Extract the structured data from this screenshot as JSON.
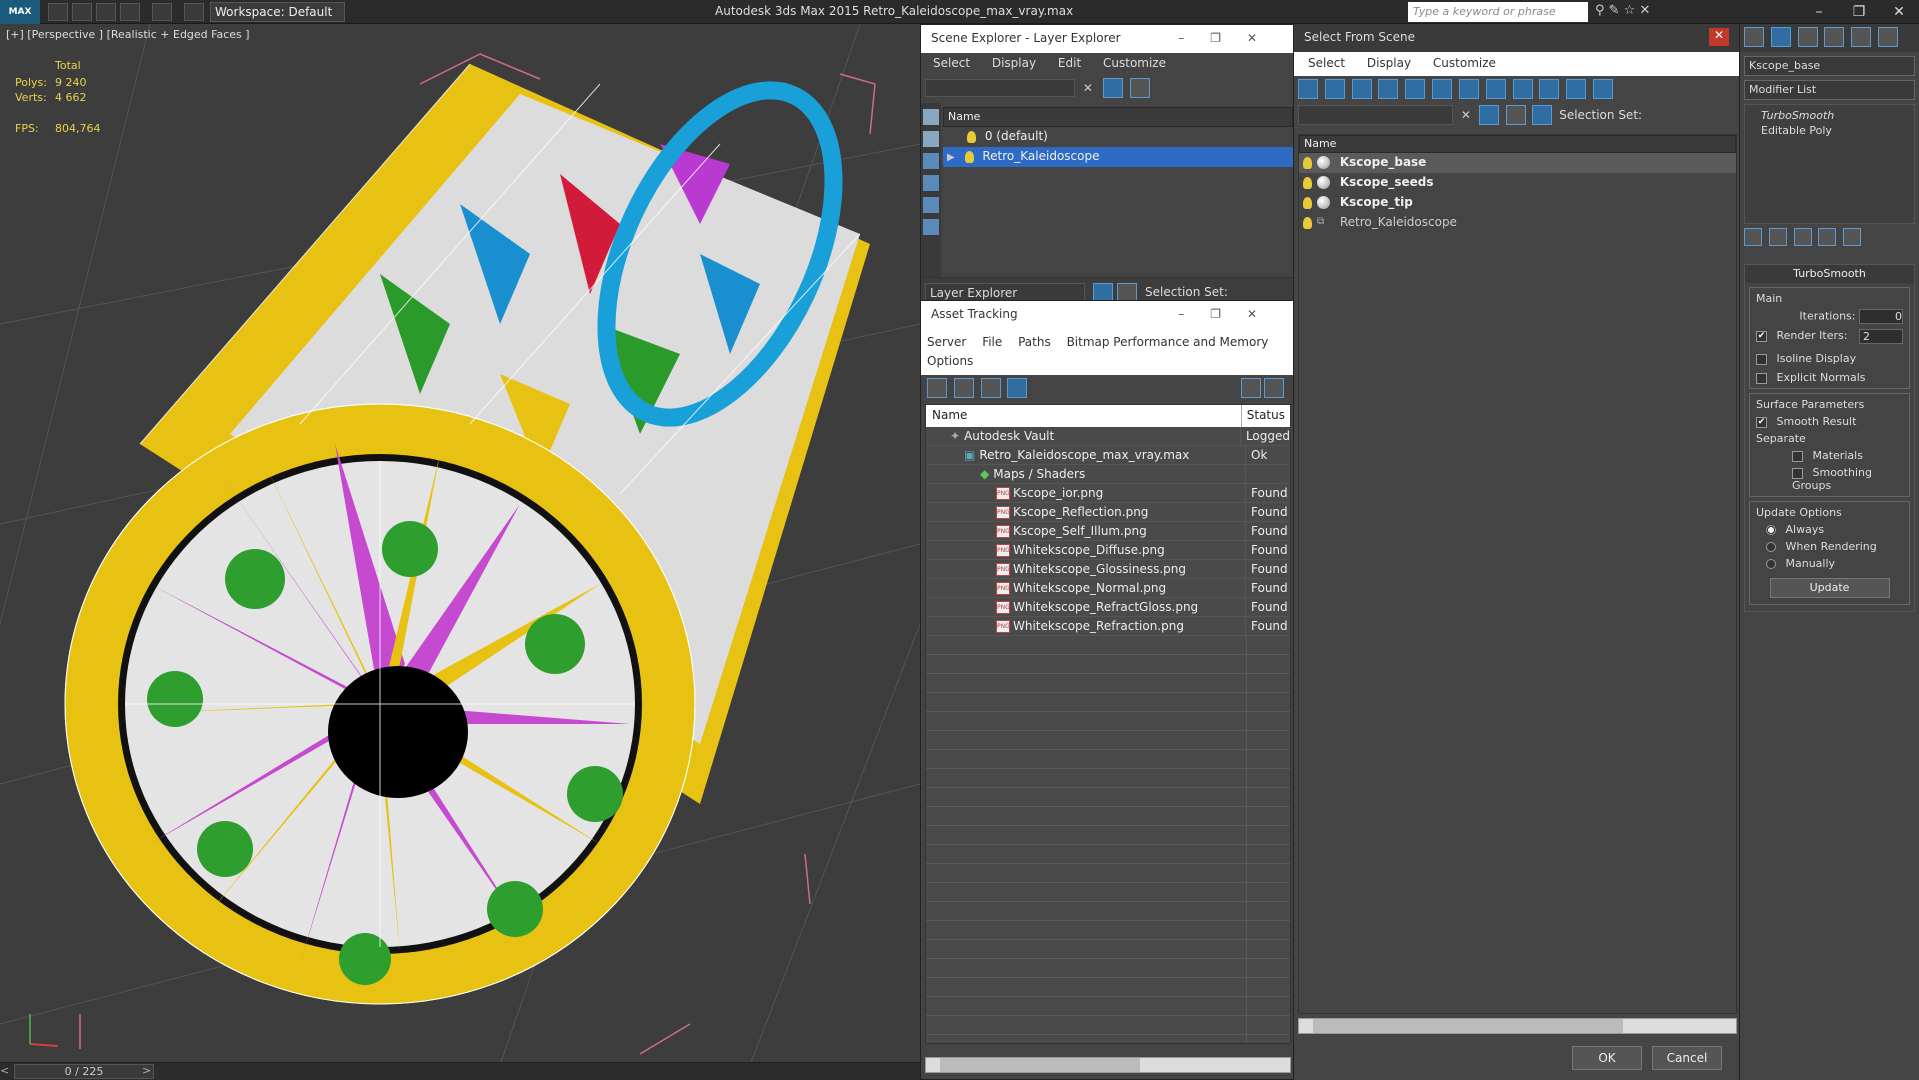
{
  "titlebar": {
    "logo": "MAX",
    "workspace": "Workspace: Default",
    "app_title": "Autodesk 3ds Max  2015     Retro_Kaleidoscope_max_vray.max",
    "search_placeholder": "Type a keyword or phrase"
  },
  "viewport": {
    "label": "[+] [Perspective ] [Realistic + Edged Faces ]",
    "stats": {
      "total_label": "Total",
      "polys_label": "Polys:",
      "polys_value": "9 240",
      "verts_label": "Verts:",
      "verts_value": "4 662",
      "fps_label": "FPS:",
      "fps_value": "804,764"
    },
    "timeline": "0 / 225"
  },
  "scene_explorer": {
    "title": "Scene Explorer - Layer Explorer",
    "menu": [
      "Select",
      "Display",
      "Edit",
      "Customize"
    ],
    "column_name": "Name",
    "layers": [
      "0 (default)",
      "Retro_Kaleidoscope"
    ],
    "footer_dropdown": "Layer Explorer",
    "selection_set_label": "Selection Set:"
  },
  "asset_tracking": {
    "title": "Asset Tracking",
    "menu": [
      "Server",
      "File",
      "Paths",
      "Bitmap Performance and Memory",
      "Options"
    ],
    "col_name": "Name",
    "col_status": "Status",
    "rows": [
      {
        "name": "Autodesk Vault",
        "status": "Logged"
      },
      {
        "name": "Retro_Kaleidoscope_max_vray.max",
        "status": "Ok"
      },
      {
        "name": "Maps / Shaders",
        "status": ""
      },
      {
        "name": "Kscope_ior.png",
        "status": "Found"
      },
      {
        "name": "Kscope_Reflection.png",
        "status": "Found"
      },
      {
        "name": "Kscope_Self_Illum.png",
        "status": "Found"
      },
      {
        "name": "Whitekscope_Diffuse.png",
        "status": "Found"
      },
      {
        "name": "Whitekscope_Glossiness.png",
        "status": "Found"
      },
      {
        "name": "Whitekscope_Normal.png",
        "status": "Found"
      },
      {
        "name": "Whitekscope_RefractGloss.png",
        "status": "Found"
      },
      {
        "name": "Whitekscope_Refraction.png",
        "status": "Found"
      }
    ]
  },
  "select_from_scene": {
    "title": "Select From Scene",
    "menu": [
      "Select",
      "Display",
      "Customize"
    ],
    "selection_set_label": "Selection Set:",
    "column_name": "Name",
    "objects": [
      "Kscope_base",
      "Kscope_seeds",
      "Kscope_tip",
      "Retro_Kaleidoscope"
    ],
    "ok": "OK",
    "cancel": "Cancel"
  },
  "command_panel": {
    "object_name": "Kscope_base",
    "modifier_list": "Modifier List",
    "stack": [
      "TurboSmooth",
      "Editable Poly"
    ],
    "rollout_title": "TurboSmooth",
    "main_label": "Main",
    "iterations_label": "Iterations:",
    "iterations_value": "0",
    "render_iters_label": "Render Iters:",
    "render_iters_value": "2",
    "isoline_label": "Isoline Display",
    "explicit_normals_label": "Explicit Normals",
    "surface_params_label": "Surface Parameters",
    "smooth_result_label": "Smooth Result",
    "separate_label": "Separate",
    "materials_label": "Materials",
    "smoothing_groups_label": "Smoothing Groups",
    "update_options_label": "Update Options",
    "always_label": "Always",
    "when_rendering_label": "When Rendering",
    "manually_label": "Manually",
    "update_button": "Update"
  }
}
